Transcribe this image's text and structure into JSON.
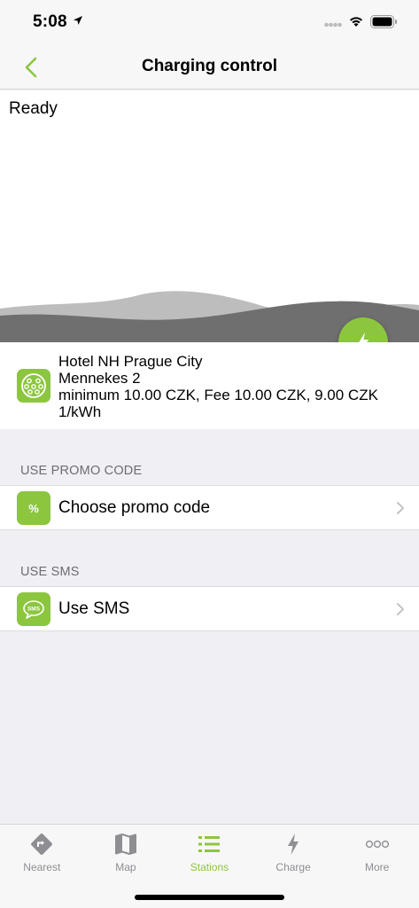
{
  "status_bar": {
    "time": "5:08"
  },
  "nav": {
    "title": "Charging control"
  },
  "hero": {
    "status": "Ready"
  },
  "station": {
    "name": "Hotel NH Prague City",
    "connector": "Mennekes 2",
    "pricing": "minimum 10.00 CZK, Fee 10.00 CZK, 9.00 CZK 1/kWh"
  },
  "promo": {
    "header": "USE PROMO CODE",
    "label": "Choose promo code",
    "icon_text": "%"
  },
  "sms": {
    "header": "USE SMS",
    "label": "Use SMS",
    "icon_text": "SMS"
  },
  "tabs": [
    {
      "label": "Nearest",
      "icon": "nearest-icon"
    },
    {
      "label": "Map",
      "icon": "map-icon"
    },
    {
      "label": "Stations",
      "icon": "stations-list-icon",
      "active": true
    },
    {
      "label": "Charge",
      "icon": "charge-bolt-icon"
    },
    {
      "label": "More",
      "icon": "more-dots-icon"
    }
  ],
  "colors": {
    "accent": "#8cc63f",
    "wave_light": "#bdbdbd",
    "wave_dark": "#6f6f6f"
  }
}
